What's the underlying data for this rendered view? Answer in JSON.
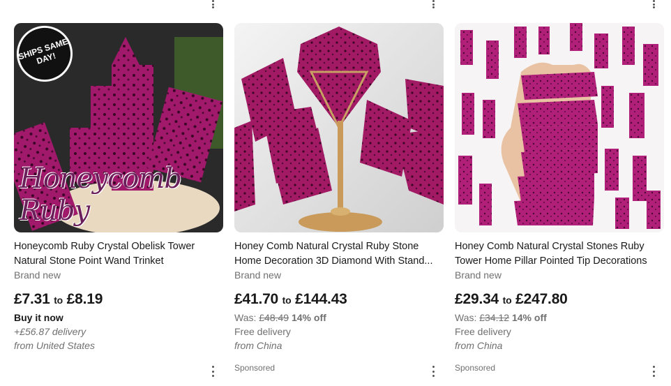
{
  "products": [
    {
      "badge": "SHIPS SAME DAY!",
      "watermark": "Honeycomb Ruby",
      "title_line1": "Honeycomb Ruby Crystal Obelisk Tower",
      "title_line2": "Natural Stone Point Wand Trinket",
      "condition": "Brand new",
      "price_low": "£7.31",
      "price_to": "to",
      "price_high": "£8.19",
      "buy_format": "Buy it now",
      "shipping": "+£56.87 delivery",
      "location": "from United States"
    },
    {
      "title_line1": "Honey Comb Natural Crystal Ruby Stone",
      "title_line2": "Home Decoration 3D Diamond With Stand...",
      "condition": "Brand new",
      "price_low": "£41.70",
      "price_to": "to",
      "price_high": "£144.43",
      "was_label": "Was:",
      "was_price": "£48.49",
      "discount": "14% off",
      "shipping": "Free delivery",
      "location": "from China",
      "sponsored": "Sponsored"
    },
    {
      "title_line1": "Honey Comb Natural Crystal Stones Ruby",
      "title_line2": "Tower Home Pillar Pointed Tip Decorations",
      "condition": "Brand new",
      "price_low": "£29.34",
      "price_to": "to",
      "price_high": "£247.80",
      "was_label": "Was:",
      "was_price": "£34.12",
      "discount": "14% off",
      "shipping": "Free delivery",
      "location": "from China",
      "sponsored": "Sponsored"
    }
  ],
  "colors": {
    "crystal": "#a0196b",
    "crystal_dark": "#6b0c47",
    "text": "#191919",
    "muted": "#707070"
  },
  "icons": [
    "more-vertical-icon"
  ]
}
